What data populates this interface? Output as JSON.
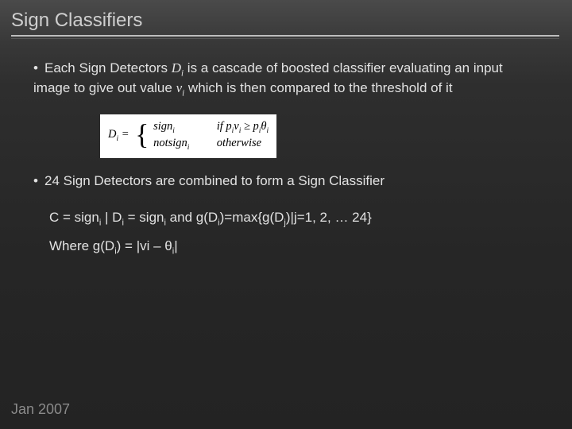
{
  "title": "Sign Classifiers",
  "bullets": {
    "b1_pre": "Each Sign Detectors ",
    "b1_var1_base": "D",
    "b1_var1_sub": "i",
    "b1_mid1": " is a cascade of boosted classifier evaluating an input image to give out value ",
    "b1_var2_base": "v",
    "b1_var2_sub": "i",
    "b1_post": " which is then compared to the threshold of it",
    "b2": "24 Sign Detectors are combined to form a Sign Classifier"
  },
  "formula": {
    "lhs_base": "D",
    "lhs_sub": "i",
    "eq": " = ",
    "case1_val": "sign",
    "case1_sub": "i",
    "case1_cond_pre": "if  p",
    "case1_cond_sub1": "i",
    "case1_cond_mid1": "v",
    "case1_cond_sub2": "i",
    "case1_cond_ge": " ≥ p",
    "case1_cond_sub3": "i",
    "case1_cond_theta": "θ",
    "case1_cond_sub4": "i",
    "case2_val": "notsign",
    "case2_sub": "i",
    "case2_cond": "otherwise"
  },
  "eq_line1": {
    "pre": "C = sign",
    "s1": "i",
    "mid1": " | D",
    "s2": "i",
    "mid2": " = sign",
    "s3": "i",
    "mid3": " and g(D",
    "s4": "i",
    "mid4": ")=max{g(D",
    "s5": "j",
    "post": ")|j=1, 2, … 24}"
  },
  "eq_line2": {
    "pre": "Where g(D",
    "s1": "i",
    "mid1": ") = |vi – ",
    "theta": "θ",
    "s2": "i",
    "post": "|"
  },
  "footer": "Jan 2007"
}
